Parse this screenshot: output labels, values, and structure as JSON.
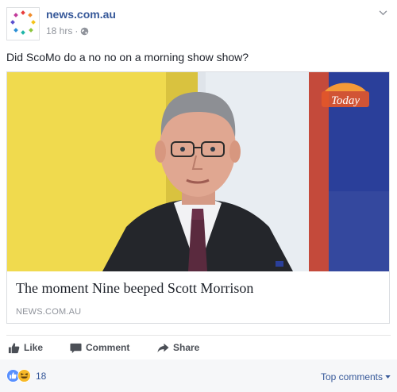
{
  "post": {
    "page_name": "news.com.au",
    "timestamp": "18 hrs",
    "separator": "·",
    "privacy_icon": "globe-icon",
    "message": "Did ScoMo do a no no on a morning show show?"
  },
  "link_card": {
    "title": "The moment Nine beeped Scott Morrison",
    "domain": "NEWS.COM.AU",
    "image_overlay_logo": "Today"
  },
  "actions": {
    "like": "Like",
    "comment": "Comment",
    "share": "Share"
  },
  "reactions": {
    "icons": [
      "like-icon",
      "haha-icon"
    ],
    "count": "18",
    "top_comments": "Top comments"
  },
  "colors": {
    "link_blue": "#365899",
    "meta_gray": "#90949c",
    "action_gray": "#4b4f56",
    "like_blue": "#5890ff",
    "haha_yellow": "#f7b928"
  }
}
